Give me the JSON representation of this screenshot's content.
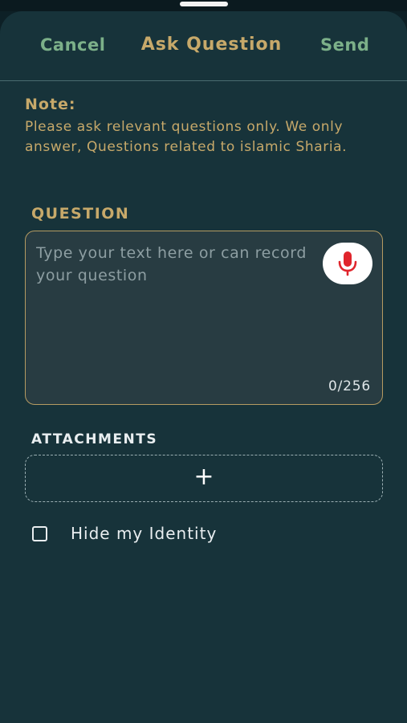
{
  "header": {
    "cancel_label": "Cancel",
    "title": "Ask Question",
    "send_label": "Send"
  },
  "note": {
    "title": "Note:",
    "text": "Please ask relevant questions only. We only answer, Questions related to islamic Sharia."
  },
  "question": {
    "label": "QUESTION",
    "value": "",
    "placeholder": "Type your text here or can record your question",
    "counter": "0/256",
    "mic_icon": "microphone-icon"
  },
  "attachments": {
    "label": "ATTACHMENTS",
    "add_symbol": "+"
  },
  "identity": {
    "label": "Hide my Identity",
    "checked": false
  },
  "colors": {
    "background": "#17333a",
    "accent_gold": "#c7a96a",
    "accent_green": "#7cb089",
    "mic_red": "#e0252c"
  }
}
